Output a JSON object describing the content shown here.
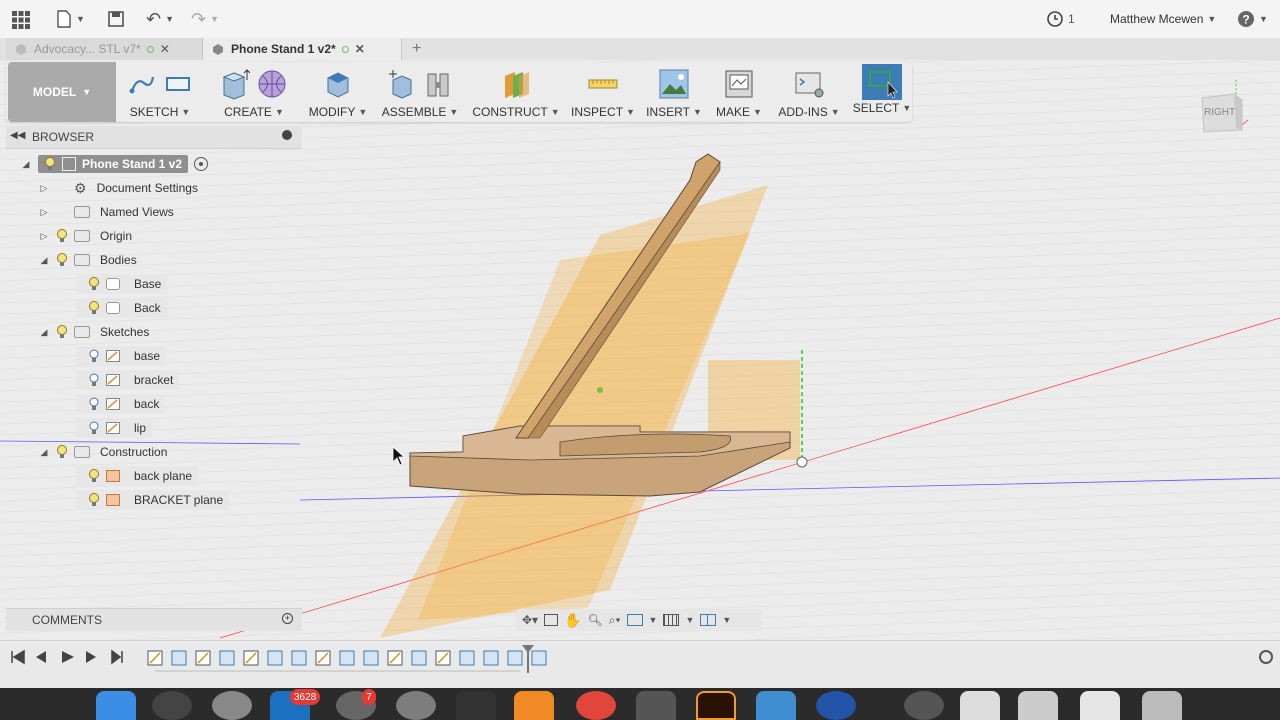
{
  "appbar": {
    "user": "Matthew Mcewen",
    "job_count": "1"
  },
  "tabs": [
    {
      "label": "Advocacy... STL v7*",
      "active": false
    },
    {
      "label": "Phone Stand 1 v2*",
      "active": true
    }
  ],
  "toolbar": {
    "workspace": "MODEL",
    "groups": [
      "SKETCH",
      "CREATE",
      "MODIFY",
      "ASSEMBLE",
      "CONSTRUCT",
      "INSPECT",
      "INSERT",
      "MAKE",
      "ADD-INS",
      "SELECT"
    ]
  },
  "viewcube": {
    "face": "RIGHT"
  },
  "browser": {
    "title": "BROWSER",
    "root": "Phone Stand 1 v2",
    "items": [
      {
        "label": "Document Settings"
      },
      {
        "label": "Named Views"
      },
      {
        "label": "Origin"
      },
      {
        "label": "Bodies"
      },
      {
        "label": "Base"
      },
      {
        "label": "Back"
      },
      {
        "label": "Sketches"
      },
      {
        "label": "base"
      },
      {
        "label": "bracket"
      },
      {
        "label": "back"
      },
      {
        "label": "lip"
      },
      {
        "label": "Construction"
      },
      {
        "label": "back plane"
      },
      {
        "label": "BRACKET plane"
      }
    ]
  },
  "comments": {
    "title": "COMMENTS"
  },
  "dock": {
    "badge_mail": "3628",
    "badge_app": "7"
  },
  "colors": {
    "accent": "#3d7cb7",
    "plane": "#f5a623",
    "body": "#cfa36a",
    "toolbar_bg": "#ececec"
  }
}
